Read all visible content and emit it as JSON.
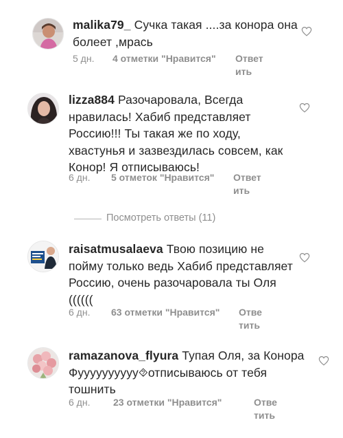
{
  "icons": {
    "like": "heart-outline-icon"
  },
  "colors": {
    "text": "#262626",
    "muted": "#8e8e8e"
  },
  "comments": [
    {
      "username": "malika79_",
      "text": "Сучка такая ....за конора она болеет ,мрась",
      "time": "5 дн.",
      "likes": "4 отметки \"Нравится\"",
      "reply": "Ответить"
    },
    {
      "username": "lizza884",
      "text": "Разочаровала, Всегда нравилась! Хабиб представляет Россию!!! Ты такая же по ходу, хвастунья и зазвездилась совсем, как Конор! Я отписываюсь!",
      "time": "6 дн.",
      "likes": "5 отметок \"Нравится\"",
      "reply": "Ответить"
    },
    {
      "username": "raisatmusalaeva",
      "text": "Твою позицию не пойму только ведь Хабиб представляет Россию, очень разочаровала ты Оля ((((((",
      "time": "6 дн.",
      "likes": "63 отметки \"Нравится\"",
      "reply": "Ответить"
    },
    {
      "username": "ramazanova_flyura",
      "text": "Тупая Оля, за Конора Фуууууууууу⯑отписываюсь от тебя тошнить",
      "time": "6 дн.",
      "likes": "23 отметки \"Нравится\"",
      "reply": "Ответить"
    }
  ],
  "view_replies": "Посмотреть ответы (11)"
}
